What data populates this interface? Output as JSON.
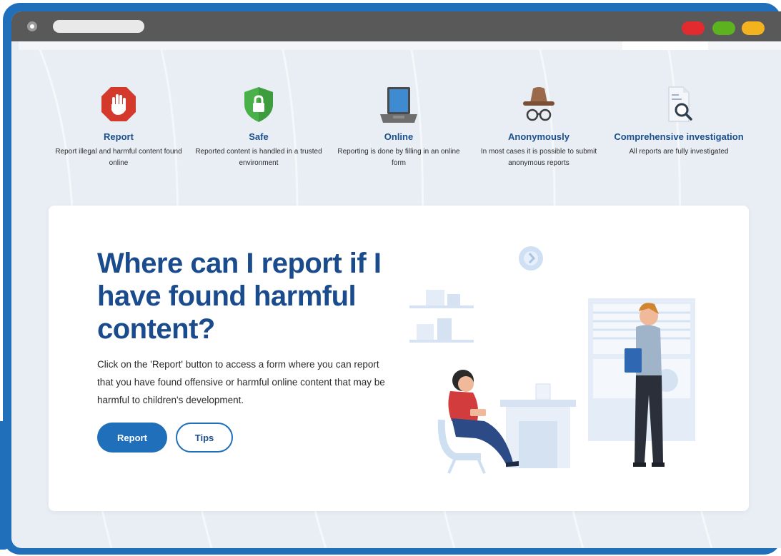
{
  "features": [
    {
      "icon": "stop-hand-icon",
      "title": "Report",
      "desc": "Report illegal and harmful content found online"
    },
    {
      "icon": "shield-lock-icon",
      "title": "Safe",
      "desc": "Reported content is handled in a trusted environment"
    },
    {
      "icon": "laptop-icon",
      "title": "Online",
      "desc": "Reporting is done by filling in an online form"
    },
    {
      "icon": "hat-glasses-icon",
      "title": "Anonymously",
      "desc": "In most cases it is possible to submit anonymous reports"
    },
    {
      "icon": "document-search-icon",
      "title": "Comprehensive investigation",
      "desc": "All reports are fully investigated"
    }
  ],
  "hero": {
    "headline": "Where can I report if I have found harmful content?",
    "body": "Click on the 'Report' button to access a form where you can report that you have found offensive or harmful online content that may be harmful to children's development.",
    "report_label": "Report",
    "tips_label": "Tips"
  },
  "colors": {
    "frame": "#1f6fba",
    "brand": "#1a4b8c",
    "titlebar": "#595959",
    "window_red": "#e12b2f",
    "window_green": "#5cb31f",
    "window_yellow": "#f2b31f"
  }
}
